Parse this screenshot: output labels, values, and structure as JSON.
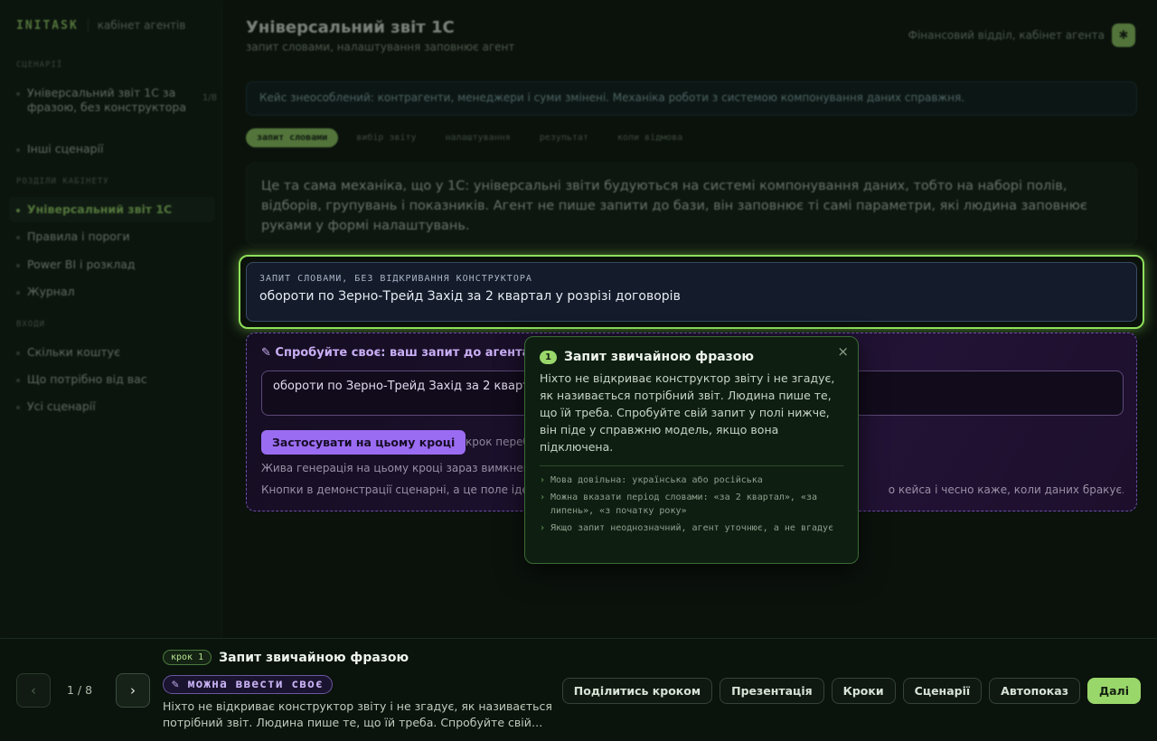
{
  "brand": {
    "logo": "INITASK",
    "subtitle": "кабінет агентів"
  },
  "sidebar": {
    "sections": [
      {
        "title": "СЦЕНАРІЇ"
      },
      {
        "title": "РОЗДІЛИ КАБІНЕТУ"
      },
      {
        "title": "ВХОДИ"
      }
    ],
    "scenarios": [
      {
        "label": "Універсальний звіт 1С за фразою, без конструктора",
        "count": "1/8"
      },
      {
        "label": "Інші сценарії"
      }
    ],
    "cabinet": [
      {
        "label": "Універсальний звіт 1С",
        "active": true
      },
      {
        "label": "Правила і пороги"
      },
      {
        "label": "Power BI і розклад"
      },
      {
        "label": "Журнал"
      }
    ],
    "entries": [
      {
        "label": "Скільки коштує"
      },
      {
        "label": "Що потрібно від вас"
      },
      {
        "label": "Усі сценарії"
      }
    ]
  },
  "header": {
    "title": "Універсальний звіт 1С",
    "subtitle": "запит словами, налаштування заповнює агент",
    "context": "Фінансовий відділ, кабінет агента",
    "avatar": "✱"
  },
  "info_banner": "Кейс знеособлений: контрагенти, менеджери і суми змінені. Механіка роботи з системою компонування даних справжня.",
  "tabs": [
    {
      "label": "запит словами",
      "active": true
    },
    {
      "label": "вибір звіту"
    },
    {
      "label": "налаштування"
    },
    {
      "label": "результат"
    },
    {
      "label": "коли відмова"
    }
  ],
  "description": "Це та сама механіка, що у 1С: універсальні звіти будуються на системі компонування даних, тобто на наборі полів, відборів, групувань і показників. Агент не пише запити до бази, він заповнює ті самі параметри, які людина заповнює руками у формі налаштувань.",
  "query": {
    "label": "ЗАПИТ СЛОВАМИ, БЕЗ ВІДКРИВАННЯ КОНСТРУКТОРА",
    "value": "обороти по Зерно-Трейд Захід за 2 квартал у розрізі договорів"
  },
  "try_panel": {
    "title": "✎ Спробуйте своє: ваш запит до агента з",
    "input_value": "обороти по Зерно-Трейд Захід за 2 квартал у розрізі договорів",
    "apply_button": "Застосувати на цьому кроці",
    "hint": "крок переб",
    "note1": "Жива генерація на цьому кроці зараз вимкнена,",
    "note2": "Кнопки в демонстрації сценарні, а це поле іде у",
    "note2_tail": "о кейса і чесно каже, коли даних бракує."
  },
  "popover": {
    "number": "1",
    "title": "Запит звичайною фразою",
    "close": "×",
    "body": "Ніхто не відкриває конструктор звіту і не згадує, як називається потрібний звіт. Людина пише те, що їй треба. Спробуйте свій запит у полі нижче, він піде у справжню модель, якщо вона підключена.",
    "bullets": [
      "Мова довільна: українська або російська",
      "Можна вказати період словами: «за 2 квартал», «за липень», «з початку року»",
      "Якщо запит неоднозначний, агент уточнює, а не вгадує"
    ]
  },
  "player": {
    "prev": "‹",
    "next": "›",
    "page": "1 / 8",
    "step_badge": "крок 1",
    "step_title": "Запит звичайною фразою",
    "edit_badge": "✎ можна ввести своє",
    "step_text": "Ніхто не відкриває конструктор звіту і не згадує, як називається потрібний звіт. Людина пише те, що їй треба. Спробуйте свій…",
    "actions": [
      "Поділитись кроком",
      "Презентація",
      "Кроки",
      "Сценарії",
      "Автопоказ",
      "Далі"
    ]
  },
  "colors": {
    "accent": "#9ad76a",
    "purple": "#9a6cf2",
    "background": "#0b120c"
  }
}
